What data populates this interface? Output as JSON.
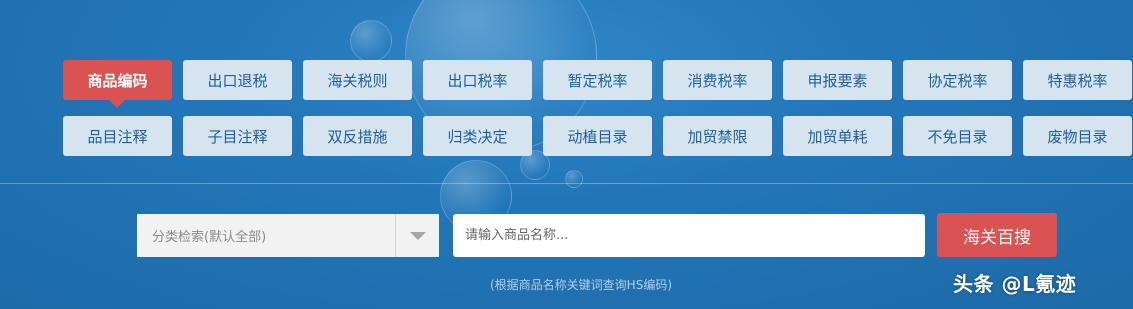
{
  "tabs": {
    "row1": [
      "商品编码",
      "出口退税",
      "海关税则",
      "出口税率",
      "暂定税率",
      "消费税率",
      "申报要素",
      "协定税率",
      "特惠税率"
    ],
    "row2": [
      "品目注释",
      "子目注释",
      "双反措施",
      "归类决定",
      "动植目录",
      "加贸禁限",
      "加贸单耗",
      "不免目录",
      "废物目录"
    ],
    "active": "商品编码"
  },
  "search": {
    "category_select": "分类检索(默认全部)",
    "placeholder": "请输入商品名称...",
    "button": "海关百搜",
    "hint": "(根据商品名称关键词查询HS编码)"
  },
  "watermark": "头条 @L氪迹",
  "colors": {
    "background": "#2276b8",
    "tab": "#d6e4f0",
    "tab_text": "#1f5f96",
    "accent": "#d95352"
  }
}
